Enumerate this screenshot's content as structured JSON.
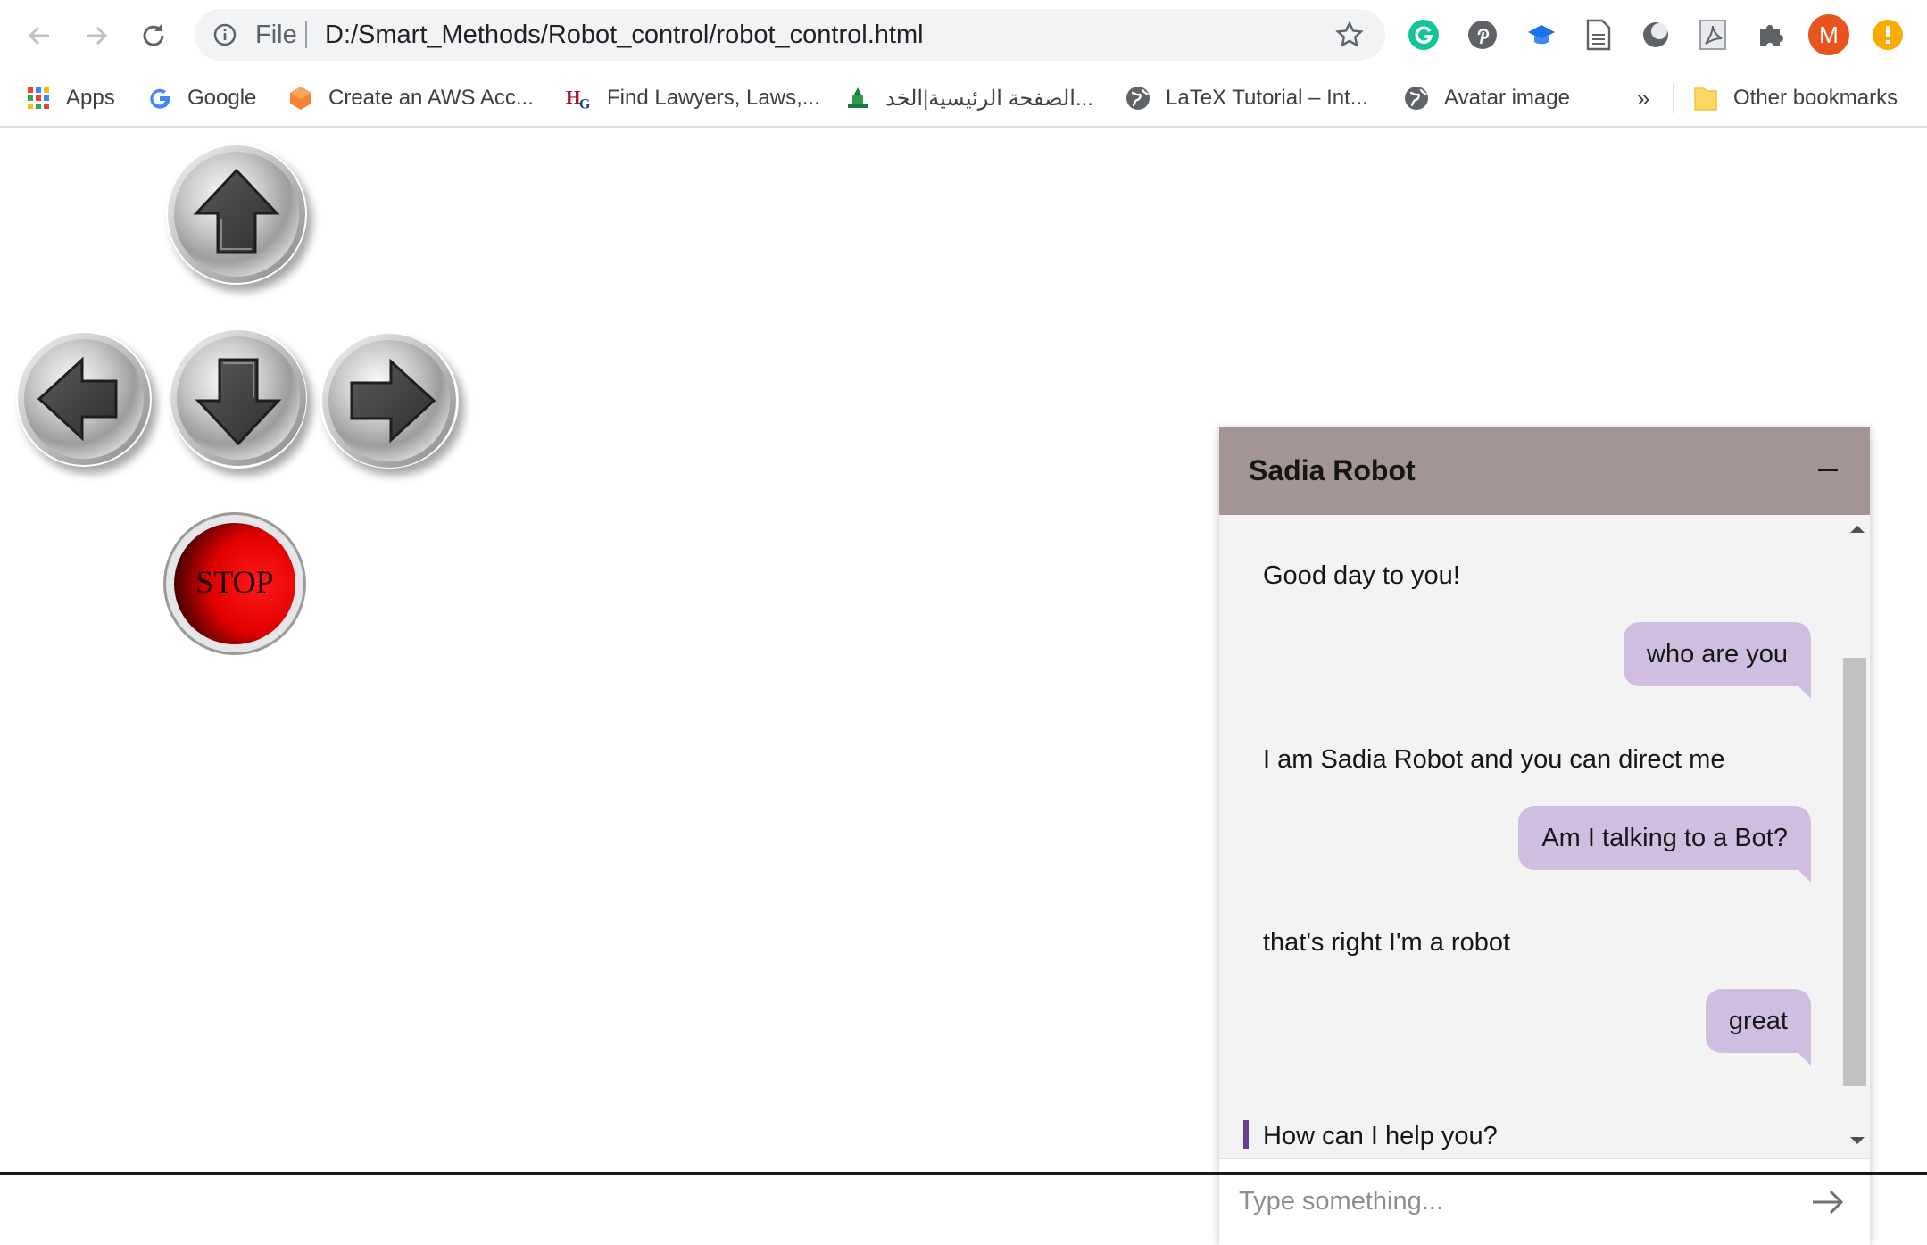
{
  "browser": {
    "scheme_label": "File",
    "url": "D:/Smart_Methods/Robot_control/robot_control.html",
    "profile_initial": "M"
  },
  "bookmarks": {
    "items": [
      {
        "label": "Apps",
        "icon": "apps-grid-icon"
      },
      {
        "label": "Google",
        "icon": "google-icon"
      },
      {
        "label": "Create an AWS Acc...",
        "icon": "aws-icon"
      },
      {
        "label": "Find Lawyers, Laws,...",
        "icon": "hg-icon"
      },
      {
        "label": "الصفحة الرئيسية|الخد...",
        "icon": "ministry-icon"
      },
      {
        "label": "LaTeX Tutorial – Int...",
        "icon": "globe-icon"
      },
      {
        "label": "Avatar image",
        "icon": "globe-icon"
      }
    ],
    "overflow_label": "»",
    "other_label": "Other bookmarks"
  },
  "controls": {
    "stop_label": "STOP"
  },
  "chat": {
    "title": "Sadia Robot",
    "messages": [
      {
        "from": "bot",
        "text": "Good day to you!"
      },
      {
        "from": "user",
        "text": "who are you"
      },
      {
        "from": "bot",
        "text": "I am Sadia Robot and you can direct me"
      },
      {
        "from": "user",
        "text": "Am I talking to a Bot?"
      },
      {
        "from": "bot",
        "text": "that's right I'm a robot"
      },
      {
        "from": "user",
        "text": "great"
      },
      {
        "from": "bot",
        "text": "How can I help you?"
      }
    ],
    "input_placeholder": "Type something...",
    "colors": {
      "header": "#a49494",
      "user_bubble": "#d0bde0",
      "accent": "#6a3d8e"
    }
  }
}
